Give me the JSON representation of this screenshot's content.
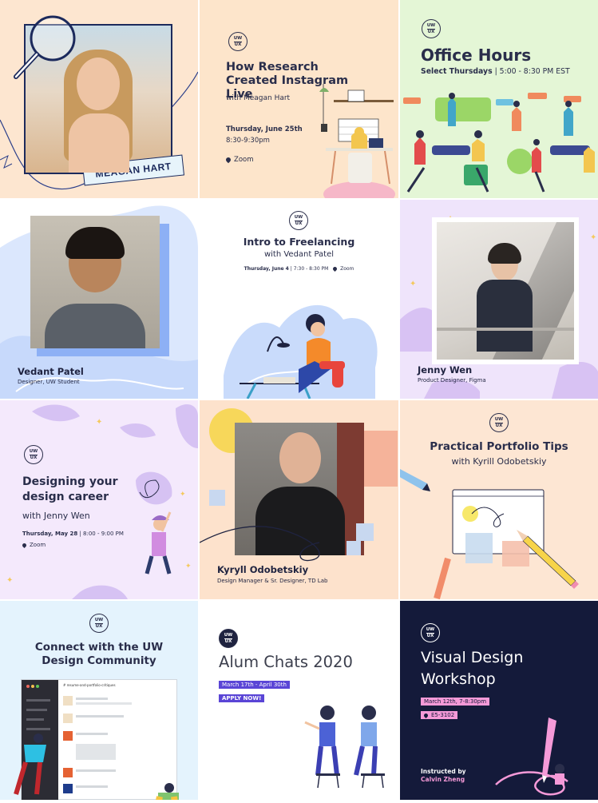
{
  "feed": {
    "logo": {
      "top": "UW",
      "bottom": "UX"
    },
    "tiles": {
      "meagan_photo": {
        "name_tag": "MEAGAN HART"
      },
      "research_live": {
        "title": "How Research Created Instagram Live",
        "subtitle": "with Meagan Hart",
        "date": "Thursday, June 25th",
        "time": "8:30-9:30pm",
        "location": "Zoom"
      },
      "office_hours": {
        "title": "Office Hours",
        "schedule_bold": "Select Thursdays",
        "schedule_rest": " | 5:00 - 8:30 PM EST"
      },
      "vedant_photo": {
        "name": "Vedant Patel",
        "role": "Designer, UW Student"
      },
      "freelancing": {
        "title": "Intro to Freelancing",
        "subtitle": "with Vedant Patel",
        "date": "Thursday, June 4",
        "time": "7:30 - 8:30 PM",
        "location": "Zoom"
      },
      "jenny_photo": {
        "name": "Jenny Wen",
        "role": "Product Designer, Figma"
      },
      "design_career": {
        "title_line1": "Designing your",
        "title_line2": "design career",
        "subtitle": "with Jenny Wen",
        "date": "Thursday, May 28",
        "time": "8:00 - 9:00 PM",
        "location": "Zoom"
      },
      "kyryll_photo": {
        "name": "Kyryll Odobetskiy",
        "role": "Design Manager & Sr. Designer, TD Lab"
      },
      "portfolio_tips": {
        "title": "Practical Portfolio Tips",
        "subtitle": "with Kyrill Odobetskiy"
      },
      "community": {
        "title_line1": "Connect with the UW",
        "title_line2": "Design Community",
        "screen_header": "# resume-and-portfolio-critiques"
      },
      "alum_chats": {
        "title": "Alum Chats 2020",
        "dates": "March 17th - April 30th",
        "cta": "APPLY NOW!"
      },
      "visual_design": {
        "title_line1": "Visual Design",
        "title_line2": "Workshop",
        "date": "March 12th, 7-8:30pm",
        "room": "E5-3102",
        "instructed_label": "Instructed by",
        "instructor": "Calvin Zheng"
      }
    },
    "colors": {
      "peach": "#fde7cf",
      "mint": "#e4f7d6",
      "lavender": "#efe6fb",
      "pale_blue": "#e6f4fd",
      "navy": "#141a3a",
      "white": "#ffffff"
    }
  }
}
